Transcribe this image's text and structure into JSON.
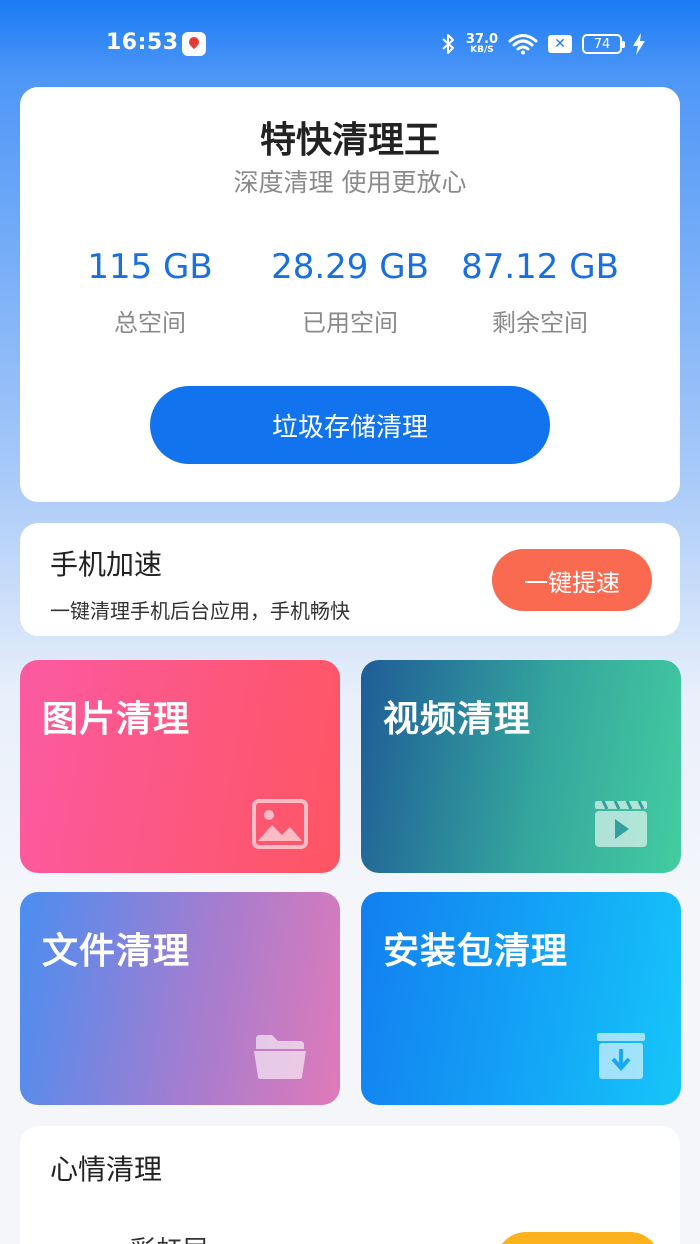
{
  "status_bar": {
    "time": "16:53",
    "net_speed_value": "37.0",
    "net_speed_unit": "KB/S",
    "battery_level": "74",
    "icons": [
      "notification-map-icon",
      "bluetooth-icon",
      "wifi-icon",
      "close-box-icon",
      "battery-icon",
      "charging-bolt-icon"
    ]
  },
  "header_card": {
    "title": "特快清理王",
    "subtitle": "深度清理  使用更放心",
    "stats": [
      {
        "value": "115 GB",
        "label": "总空间"
      },
      {
        "value": "28.29 GB",
        "label": "已用空间"
      },
      {
        "value": "87.12 GB",
        "label": "剩余空间"
      }
    ],
    "clean_button": "垃圾存储清理"
  },
  "boost_card": {
    "title": "手机加速",
    "description": "一键清理手机后台应用，手机畅快",
    "button": "一键提速"
  },
  "tiles": [
    {
      "label": "图片清理",
      "icon": "image-icon",
      "colors": [
        "#fb5aa2",
        "#fe5562"
      ]
    },
    {
      "label": "视频清理",
      "icon": "video-clapper-icon",
      "colors": [
        "#1f5c97",
        "#43cda0"
      ]
    },
    {
      "label": "文件清理",
      "icon": "folder-icon",
      "colors": [
        "#4a8ef0",
        "#e07ab8"
      ]
    },
    {
      "label": "安装包清理",
      "icon": "archive-download-icon",
      "colors": [
        "#137ff0",
        "#16c6f8"
      ]
    }
  ],
  "mood_card": {
    "title": "心情清理",
    "item_label": "彩虹屁"
  },
  "colors": {
    "primary": "#1273ee",
    "accent_orange": "#f96a50",
    "accent_yellow": "#fbb21c",
    "stat_blue": "#1a6fe0"
  }
}
